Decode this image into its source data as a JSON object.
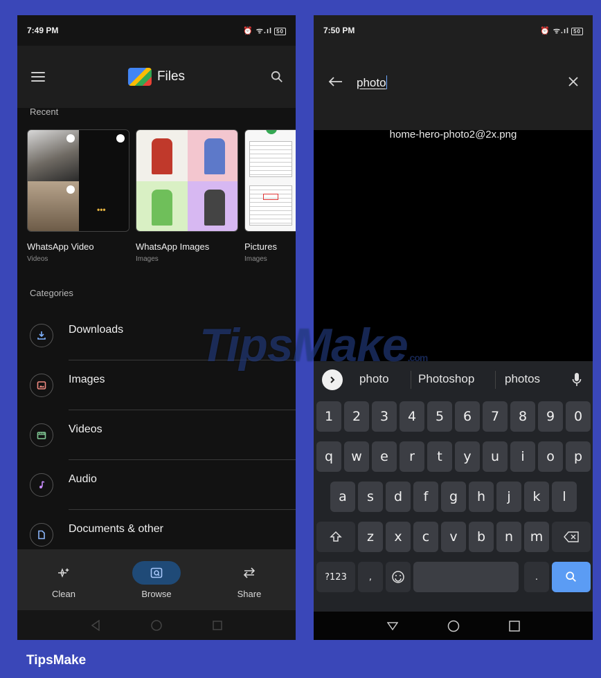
{
  "left": {
    "status": {
      "time": "7:49 PM",
      "icons": "⏰ ᯤ.ıl",
      "battery": "50"
    },
    "app_title": "Files",
    "recent_label": "Recent",
    "recent": [
      {
        "name": "WhatsApp Video",
        "sub": "Videos"
      },
      {
        "name": "WhatsApp Images",
        "sub": "Images"
      },
      {
        "name": "Pictures",
        "sub": "Images"
      }
    ],
    "more_glyph": "•••",
    "categories_label": "Categories",
    "categories": [
      {
        "label": "Downloads",
        "icon": "download-icon"
      },
      {
        "label": "Images",
        "icon": "image-icon"
      },
      {
        "label": "Videos",
        "icon": "video-icon"
      },
      {
        "label": "Audio",
        "icon": "music-note-icon"
      },
      {
        "label": "Documents & other",
        "icon": "document-icon"
      }
    ],
    "bottom_nav": [
      {
        "label": "Clean",
        "icon": "sparkle-icon"
      },
      {
        "label": "Browse",
        "icon": "browse-icon",
        "active": true
      },
      {
        "label": "Share",
        "icon": "swap-arrows-icon"
      }
    ]
  },
  "right": {
    "status": {
      "time": "7:50 PM",
      "icons": "⏰ ᯤ.ıl",
      "battery": "50"
    },
    "search_query": "photo",
    "suggestion": "home-hero-photo2@2x.png",
    "kb_suggestions": [
      "photo",
      "Photoshop",
      "photos"
    ],
    "keys": {
      "numbers": [
        "1",
        "2",
        "3",
        "4",
        "5",
        "6",
        "7",
        "8",
        "9",
        "0"
      ],
      "row1": [
        "q",
        "w",
        "e",
        "r",
        "t",
        "y",
        "u",
        "i",
        "o",
        "p"
      ],
      "row2": [
        "a",
        "s",
        "d",
        "f",
        "g",
        "h",
        "j",
        "k",
        "l"
      ],
      "row3": [
        "z",
        "x",
        "c",
        "v",
        "b",
        "n",
        "m"
      ],
      "symbols_key": "?123",
      "comma": ",",
      "period": "."
    }
  },
  "watermark": {
    "brand": "TipsMake",
    "suffix": ".com"
  },
  "footer_brand": "TipsMake",
  "colors": {
    "frame": "#3a47b8",
    "accent": "#5b9cf4",
    "nav_active": "#1f4a77"
  }
}
